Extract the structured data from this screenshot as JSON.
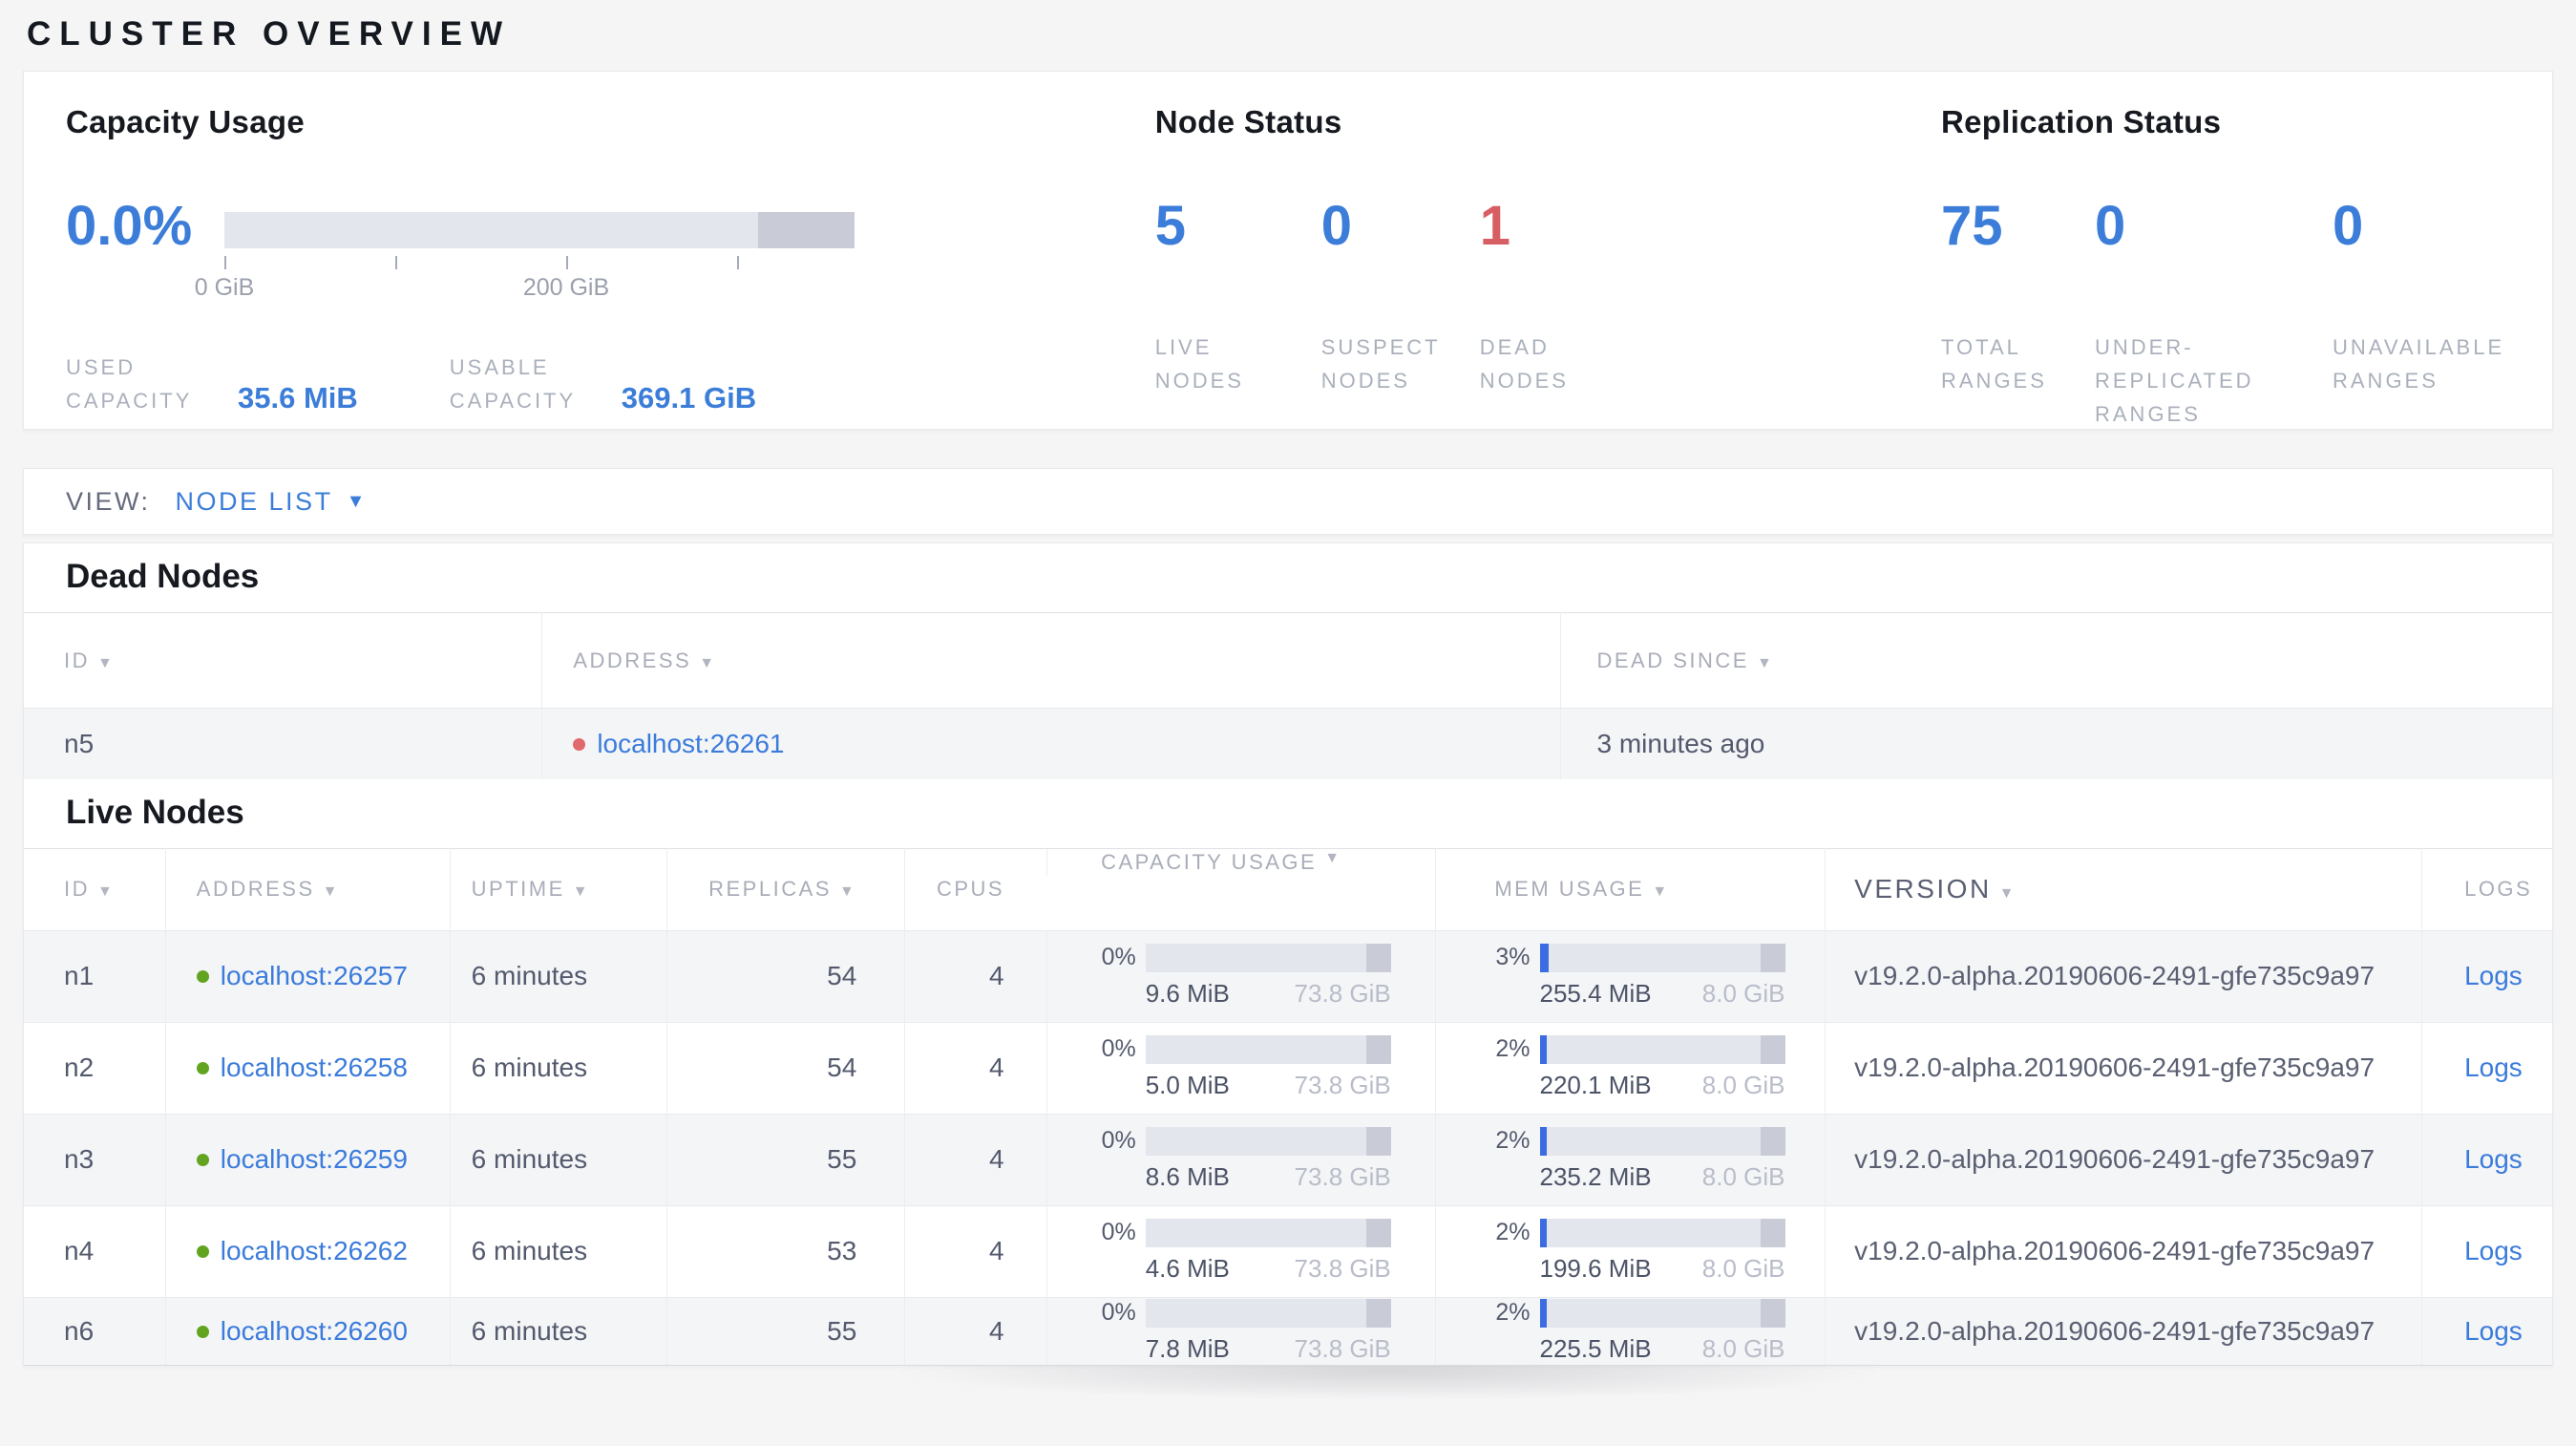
{
  "page": {
    "title": "CLUSTER OVERVIEW"
  },
  "icons": {
    "sort": "▼",
    "dropdown": "▼"
  },
  "colors": {
    "accent_blue": "#3b7dd8",
    "link_blue": "#3b7bdb",
    "dead_red": "#d75e63",
    "live_dot_green": "#62a420",
    "dead_dot_red": "#e0696e",
    "bar_track": "#e4e6ee",
    "bar_other": "#c9ccd7",
    "bar_fill": "#3b6ce2"
  },
  "summary": {
    "capacity": {
      "title": "Capacity Usage",
      "percent": "0.0%",
      "tick_label_0": "0 GiB",
      "tick_label_200": "200 GiB",
      "used_label": "USED CAPACITY",
      "used_value": "35.6 MiB",
      "usable_label": "USABLE CAPACITY",
      "usable_value": "369.1 GiB"
    },
    "node_status": {
      "title": "Node Status",
      "stats": [
        {
          "value": "5",
          "label": "LIVE NODES"
        },
        {
          "value": "0",
          "label": "SUSPECT NODES"
        },
        {
          "value": "1",
          "label": "DEAD NODES"
        }
      ]
    },
    "replication": {
      "title": "Replication Status",
      "stats": [
        {
          "value": "75",
          "label": "TOTAL RANGES"
        },
        {
          "value": "0",
          "label": "UNDER-REPLICATED RANGES"
        },
        {
          "value": "0",
          "label": "UNAVAILABLE RANGES"
        }
      ]
    }
  },
  "view_bar": {
    "label": "VIEW:",
    "selected": "NODE LIST"
  },
  "dead_nodes": {
    "title": "Dead Nodes",
    "columns": [
      {
        "label": "ID"
      },
      {
        "label": "ADDRESS"
      },
      {
        "label": "DEAD SINCE"
      }
    ],
    "rows": [
      {
        "id": "n5",
        "address": "localhost:26261",
        "dead_since": "3 minutes ago"
      }
    ]
  },
  "live_nodes": {
    "title": "Live Nodes",
    "columns": [
      {
        "label": "ID"
      },
      {
        "label": "ADDRESS"
      },
      {
        "label": "UPTIME"
      },
      {
        "label": "REPLICAS"
      },
      {
        "label": "CPUS"
      },
      {
        "label": "CAPACITY USAGE"
      },
      {
        "label": "MEM USAGE"
      },
      {
        "label": "VERSION"
      },
      {
        "label": "LOGS"
      }
    ],
    "rows": [
      {
        "id": "n1",
        "address": "localhost:26257",
        "uptime": "6 minutes",
        "replicas": "54",
        "cpus": "4",
        "capacity_pct": "0%",
        "capacity_used": "9.6 MiB",
        "capacity_total": "73.8 GiB",
        "mem_pct": "3%",
        "mem_used": "255.4 MiB",
        "mem_total": "8.0 GiB",
        "version": "v19.2.0-alpha.20190606-2491-gfe735c9a97",
        "logs": "Logs"
      },
      {
        "id": "n2",
        "address": "localhost:26258",
        "uptime": "6 minutes",
        "replicas": "54",
        "cpus": "4",
        "capacity_pct": "0%",
        "capacity_used": "5.0 MiB",
        "capacity_total": "73.8 GiB",
        "mem_pct": "2%",
        "mem_used": "220.1 MiB",
        "mem_total": "8.0 GiB",
        "version": "v19.2.0-alpha.20190606-2491-gfe735c9a97",
        "logs": "Logs"
      },
      {
        "id": "n3",
        "address": "localhost:26259",
        "uptime": "6 minutes",
        "replicas": "55",
        "cpus": "4",
        "capacity_pct": "0%",
        "capacity_used": "8.6 MiB",
        "capacity_total": "73.8 GiB",
        "mem_pct": "2%",
        "mem_used": "235.2 MiB",
        "mem_total": "8.0 GiB",
        "version": "v19.2.0-alpha.20190606-2491-gfe735c9a97",
        "logs": "Logs"
      },
      {
        "id": "n4",
        "address": "localhost:26262",
        "uptime": "6 minutes",
        "replicas": "53",
        "cpus": "4",
        "capacity_pct": "0%",
        "capacity_used": "4.6 MiB",
        "capacity_total": "73.8 GiB",
        "mem_pct": "2%",
        "mem_used": "199.6 MiB",
        "mem_total": "8.0 GiB",
        "version": "v19.2.0-alpha.20190606-2491-gfe735c9a97",
        "logs": "Logs"
      },
      {
        "id": "n6",
        "address": "localhost:26260",
        "uptime": "6 minutes",
        "replicas": "55",
        "cpus": "4",
        "capacity_pct": "0%",
        "capacity_used": "7.8 MiB",
        "capacity_total": "73.8 GiB",
        "mem_pct": "2%",
        "mem_used": "225.5 MiB",
        "mem_total": "8.0 GiB",
        "version": "v19.2.0-alpha.20190606-2491-gfe735c9a97",
        "logs": "Logs"
      }
    ]
  }
}
